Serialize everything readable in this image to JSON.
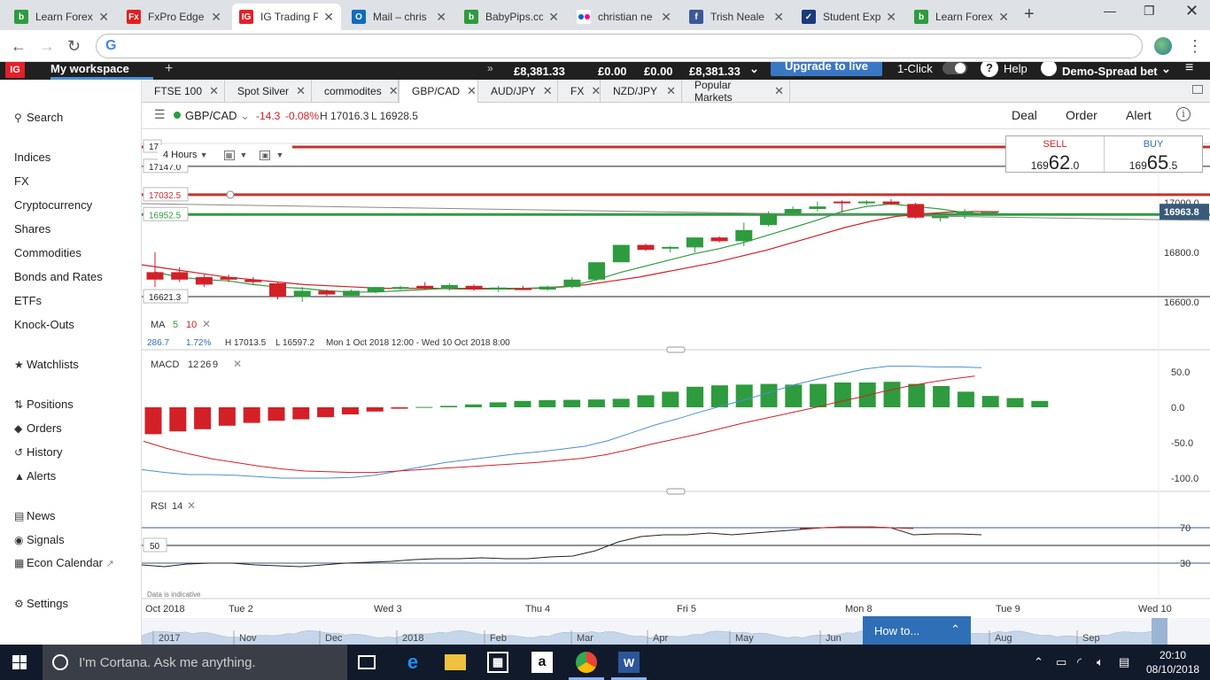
{
  "browser": {
    "tabs": [
      {
        "label": "Learn Forex",
        "favicon_color": "#2e9b3e",
        "favicon_text": "b",
        "icon": "babypips-icon"
      },
      {
        "label": "FxPro Edge",
        "favicon_color": "#e02020",
        "favicon_text": "Fx",
        "icon": "fxpro-icon"
      },
      {
        "label": "IG Trading Pl",
        "favicon_color": "#e4202a",
        "favicon_text": "IG",
        "icon": "ig-icon"
      },
      {
        "label": "Mail – chris",
        "favicon_color": "#0f6cbd",
        "favicon_text": "O",
        "icon": "outlook-icon"
      },
      {
        "label": "BabyPips.co",
        "favicon_color": "#2e9b3e",
        "favicon_text": "b",
        "icon": "babypips-icon"
      },
      {
        "label": "christian ne",
        "favicon_color": "#ffffff",
        "favicon_text": "",
        "icon": "flickr-icon"
      },
      {
        "label": "Trish Neale",
        "favicon_color": "#3b5998",
        "favicon_text": "f",
        "icon": "facebook-icon"
      },
      {
        "label": "Student Exp",
        "favicon_color": "#1a3a7a",
        "favicon_text": "✓",
        "icon": "student-icon"
      },
      {
        "label": "Learn Forex",
        "favicon_color": "#2e9b3e",
        "favicon_text": "b",
        "icon": "babypips-icon"
      }
    ],
    "active_tab": 2,
    "new_tab": "+",
    "address": "",
    "omnibox_g": "G"
  },
  "ig": {
    "logo": "IG",
    "workspace": "My workspace",
    "add": "+",
    "arrows": "»",
    "funds": "£8,381.33",
    "pl": "£0.00",
    "margin": "£0.00",
    "available": "£8,381.33",
    "upgrade": "Upgrade to live",
    "one_click": "1-Click",
    "help": "Help",
    "help_icon": "?",
    "account": "Demo-Spread bet",
    "menu": "≡"
  },
  "sidebar": {
    "search": "Search",
    "markets": [
      "Indices",
      "FX",
      "Cryptocurrency",
      "Shares",
      "Commodities",
      "Bonds and Rates",
      "ETFs",
      "Knock-Outs"
    ],
    "watchlists": "Watchlists",
    "trading": [
      "Positions",
      "Orders",
      "History",
      "Alerts"
    ],
    "info": [
      "News",
      "Signals",
      "Econ Calendar"
    ],
    "settings": "Settings"
  },
  "market_tabs": [
    "FTSE 100",
    "Spot Silver",
    "commodites",
    "GBP/CAD",
    "AUD/JPY",
    "FX",
    "NZD/JPY",
    "Popular Markets"
  ],
  "active_market_tab": 3,
  "instrument": {
    "name": "GBP/CAD",
    "change": "-14.3",
    "change_pct": "-0.08%",
    "high": "H 17016.3",
    "low": "L 16928.5",
    "deal": "Deal",
    "order": "Order",
    "alert": "Alert",
    "info_icon": "i"
  },
  "timeframe": "4 Hours",
  "quote": {
    "sell_label": "SELL",
    "sell_prefix": "169",
    "sell_big": "62",
    "sell_suffix": ".0",
    "buy_label": "BUY",
    "buy_prefix": "169",
    "buy_big": "65",
    "buy_suffix": ".5"
  },
  "price_panel": {
    "axis_labels": [
      "17000.0",
      "16800.0",
      "16600.0"
    ],
    "current_price": "16963.8",
    "left_labels": [
      "17147.0",
      "17032.5",
      "16952.5",
      "16621.3"
    ],
    "partial_label": "17",
    "ma_label": "MA",
    "ma_fast": "5",
    "ma_slow": "10",
    "stats": [
      "286.7",
      "1.72%",
      "H 17013.5",
      "L 16597.2",
      "Mon 1 Oct 2018 12:00 - Wed 10 Oct 2018 8:00"
    ]
  },
  "macd_panel": {
    "label": "MACD",
    "params": [
      "12",
      "26",
      "9"
    ],
    "axis_labels": [
      "50.0",
      "0.0",
      "-50.0",
      "-100.0"
    ],
    "histogram": [
      -38,
      -34,
      -31,
      -26,
      -22,
      -19,
      -17,
      -14,
      -10,
      -6,
      -2,
      0.5,
      2,
      4,
      7,
      9,
      10,
      10.5,
      11,
      12,
      17,
      22,
      29,
      31,
      32,
      33,
      32,
      33,
      35,
      35,
      36,
      33,
      30,
      22,
      16,
      13,
      9
    ],
    "macd_line": [
      -88,
      -92,
      -95,
      -95,
      -96,
      -98,
      -100,
      -100,
      -100,
      -99,
      -96,
      -90,
      -84,
      -78,
      -74,
      -70,
      -66,
      -63,
      -59,
      -55,
      -47,
      -36,
      -25,
      -16,
      -6,
      3,
      12,
      22,
      32,
      40,
      47,
      54,
      58,
      58,
      57,
      57,
      56
    ],
    "signal_line": [
      -48,
      -58,
      -66,
      -73,
      -78,
      -83,
      -87,
      -90,
      -91,
      -92,
      -92,
      -90,
      -88,
      -86,
      -84,
      -82,
      -80,
      -78,
      -75,
      -72,
      -67,
      -60,
      -52,
      -45,
      -38,
      -30,
      -22,
      -15,
      -8,
      -1,
      7,
      14,
      22,
      29,
      35,
      40,
      44
    ]
  },
  "rsi_panel": {
    "label": "RSI",
    "period": "14",
    "axis_labels": [
      "70",
      "30"
    ],
    "level_label": "50",
    "values": [
      28,
      26,
      29,
      30,
      30,
      28,
      27,
      26,
      28,
      30,
      31,
      32,
      34,
      35,
      35,
      36,
      35,
      35,
      37,
      38,
      44,
      54,
      60,
      62,
      62,
      64,
      62,
      64,
      66,
      68,
      70,
      71,
      71,
      70,
      62,
      63,
      63,
      62
    ],
    "note": "Data is indicative"
  },
  "x_axis": [
    "Oct 2018",
    "Tue 2",
    "Wed 3",
    "Thu 4",
    "Fri 5",
    "Mon 8",
    "Tue 9",
    "Wed 10"
  ],
  "navigator_labels": [
    "2017",
    "Nov",
    "Dec",
    "2018",
    "Feb",
    "Mar",
    "Apr",
    "May",
    "Jun",
    "Aug",
    "Sep"
  ],
  "how_to": "How to...",
  "how_to_caret": "⌃",
  "chart_data": {
    "type": "candlestick",
    "title": "GBP/CAD",
    "timeframe": "4 Hours",
    "ylim": [
      16550,
      17120
    ],
    "candles": [
      {
        "o": 16720,
        "h": 16800,
        "l": 16660,
        "c": 16690
      },
      {
        "o": 16720,
        "h": 16740,
        "l": 16680,
        "c": 16690
      },
      {
        "o": 16700,
        "h": 16710,
        "l": 16660,
        "c": 16670
      },
      {
        "o": 16700,
        "h": 16710,
        "l": 16680,
        "c": 16690
      },
      {
        "o": 16690,
        "h": 16700,
        "l": 16670,
        "c": 16680
      },
      {
        "o": 16675,
        "h": 16680,
        "l": 16610,
        "c": 16620
      },
      {
        "o": 16620,
        "h": 16660,
        "l": 16600,
        "c": 16645
      },
      {
        "o": 16645,
        "h": 16650,
        "l": 16620,
        "c": 16630
      },
      {
        "o": 16625,
        "h": 16650,
        "l": 16620,
        "c": 16645
      },
      {
        "o": 16640,
        "h": 16660,
        "l": 16635,
        "c": 16660
      },
      {
        "o": 16655,
        "h": 16665,
        "l": 16650,
        "c": 16660
      },
      {
        "o": 16665,
        "h": 16680,
        "l": 16650,
        "c": 16655
      },
      {
        "o": 16655,
        "h": 16675,
        "l": 16645,
        "c": 16668
      },
      {
        "o": 16665,
        "h": 16670,
        "l": 16645,
        "c": 16650
      },
      {
        "o": 16650,
        "h": 16665,
        "l": 16640,
        "c": 16658
      },
      {
        "o": 16655,
        "h": 16665,
        "l": 16650,
        "c": 16652
      },
      {
        "o": 16650,
        "h": 16665,
        "l": 16645,
        "c": 16662
      },
      {
        "o": 16660,
        "h": 16700,
        "l": 16655,
        "c": 16690
      },
      {
        "o": 16690,
        "h": 16760,
        "l": 16685,
        "c": 16760
      },
      {
        "o": 16760,
        "h": 16830,
        "l": 16760,
        "c": 16830
      },
      {
        "o": 16830,
        "h": 16835,
        "l": 16805,
        "c": 16810
      },
      {
        "o": 16815,
        "h": 16825,
        "l": 16800,
        "c": 16822
      },
      {
        "o": 16820,
        "h": 16860,
        "l": 16800,
        "c": 16860
      },
      {
        "o": 16860,
        "h": 16865,
        "l": 16840,
        "c": 16845
      },
      {
        "o": 16845,
        "h": 16920,
        "l": 16825,
        "c": 16890
      },
      {
        "o": 16910,
        "h": 16965,
        "l": 16905,
        "c": 16955
      },
      {
        "o": 16955,
        "h": 16985,
        "l": 16950,
        "c": 16975
      },
      {
        "o": 16975,
        "h": 17005,
        "l": 16965,
        "c": 16985
      },
      {
        "o": 17005,
        "h": 17010,
        "l": 16960,
        "c": 17000
      },
      {
        "o": 17000,
        "h": 17010,
        "l": 16990,
        "c": 17005
      },
      {
        "o": 17005,
        "h": 17015,
        "l": 16990,
        "c": 16995
      },
      {
        "o": 16995,
        "h": 17000,
        "l": 16935,
        "c": 16940
      },
      {
        "o": 16940,
        "h": 16960,
        "l": 16925,
        "c": 16945
      },
      {
        "o": 16950,
        "h": 16975,
        "l": 16935,
        "c": 16965
      },
      {
        "o": 16960,
        "h": 16965,
        "l": 16955,
        "c": 16962
      }
    ],
    "ma5": [
      16720,
      16700,
      16690,
      16685,
      16670,
      16660,
      16655,
      16645,
      16640,
      16640,
      16645,
      16650,
      16655,
      16655,
      16655,
      16655,
      16658,
      16665,
      16690,
      16720,
      16745,
      16770,
      16795,
      16815,
      16840,
      16870,
      16900,
      16930,
      16965,
      16985,
      16995,
      16985,
      16975,
      16960,
      16955
    ],
    "ma10": [
      16760,
      16745,
      16730,
      16715,
      16700,
      16690,
      16680,
      16670,
      16665,
      16660,
      16655,
      16655,
      16655,
      16652,
      16652,
      16652,
      16655,
      16660,
      16670,
      16685,
      16700,
      16720,
      16740,
      16760,
      16785,
      16810,
      16840,
      16870,
      16900,
      16925,
      16945,
      16955,
      16962,
      16965,
      16964
    ],
    "horizontal_lines": [
      17147.0,
      17032.5,
      16952.5,
      16621.3
    ],
    "current_price": 16963.8,
    "colors": {
      "up": "#2e9b3e",
      "down": "#d32027",
      "ma5": "#2e9b3e",
      "ma10": "#d32027",
      "macd": "#4a8fd4",
      "signal": "#d32027",
      "rsi_high": "#d32027"
    }
  }
}
